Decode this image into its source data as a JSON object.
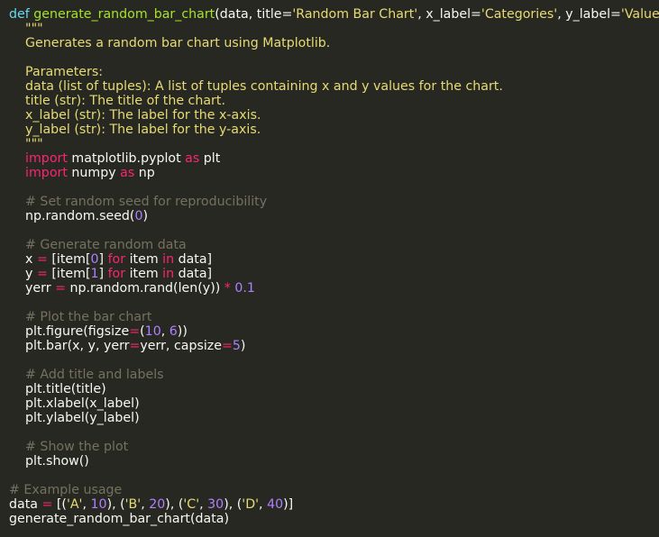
{
  "editor": {
    "language": "python",
    "theme_colors": {
      "background": "#272822",
      "text": "#f8f8f2",
      "keyword": "#66d9ef",
      "function": "#a6e22e",
      "string": "#e6db74",
      "number": "#ae81ff",
      "operator": "#f92672",
      "comment": "#75715e"
    },
    "lines": [
      [
        [
          "kw",
          "def "
        ],
        [
          "fn",
          "generate_random_bar_chart"
        ],
        [
          "p",
          "(data, title="
        ],
        [
          "str",
          "'Random Bar Chart'"
        ],
        [
          "p",
          ", x_label="
        ],
        [
          "str",
          "'Categories'"
        ],
        [
          "p",
          ", y_label="
        ],
        [
          "str",
          "'Values'"
        ],
        [
          "p",
          "):"
        ]
      ],
      [
        [
          "str",
          "    \"\"\""
        ]
      ],
      [
        [
          "str",
          "    Generates a random bar chart using Matplotlib."
        ]
      ],
      [],
      [
        [
          "str",
          "    Parameters:"
        ]
      ],
      [
        [
          "str",
          "    data (list of tuples): A list of tuples containing x and y values for the chart."
        ]
      ],
      [
        [
          "str",
          "    title (str): The title of the chart."
        ]
      ],
      [
        [
          "str",
          "    x_label (str): The label for the x-axis."
        ]
      ],
      [
        [
          "str",
          "    y_label (str): The label for the y-axis."
        ]
      ],
      [
        [
          "str",
          "    \"\"\""
        ]
      ],
      [
        [
          "p",
          "    "
        ],
        [
          "kw2",
          "import"
        ],
        [
          "p",
          " matplotlib.pyplot "
        ],
        [
          "kw2",
          "as"
        ],
        [
          "p",
          " plt"
        ]
      ],
      [
        [
          "p",
          "    "
        ],
        [
          "kw2",
          "import"
        ],
        [
          "p",
          " numpy "
        ],
        [
          "kw2",
          "as"
        ],
        [
          "p",
          " np"
        ]
      ],
      [],
      [
        [
          "cm",
          "    # Set random seed for reproducibility"
        ]
      ],
      [
        [
          "p",
          "    np.random.seed("
        ],
        [
          "num",
          "0"
        ],
        [
          "p",
          ")"
        ]
      ],
      [],
      [
        [
          "cm",
          "    # Generate random data"
        ]
      ],
      [
        [
          "p",
          "    x "
        ],
        [
          "op",
          "="
        ],
        [
          "p",
          " [item["
        ],
        [
          "num",
          "0"
        ],
        [
          "p",
          "] "
        ],
        [
          "kw2",
          "for"
        ],
        [
          "p",
          " item "
        ],
        [
          "kw2",
          "in"
        ],
        [
          "p",
          " data]"
        ]
      ],
      [
        [
          "p",
          "    y "
        ],
        [
          "op",
          "="
        ],
        [
          "p",
          " [item["
        ],
        [
          "num",
          "1"
        ],
        [
          "p",
          "] "
        ],
        [
          "kw2",
          "for"
        ],
        [
          "p",
          " item "
        ],
        [
          "kw2",
          "in"
        ],
        [
          "p",
          " data]"
        ]
      ],
      [
        [
          "p",
          "    yerr "
        ],
        [
          "op",
          "="
        ],
        [
          "p",
          " np.random.rand(len(y)) "
        ],
        [
          "op",
          "*"
        ],
        [
          "p",
          " "
        ],
        [
          "num",
          "0.1"
        ]
      ],
      [],
      [
        [
          "cm",
          "    # Plot the bar chart"
        ]
      ],
      [
        [
          "p",
          "    plt.figure(figsize"
        ],
        [
          "op",
          "="
        ],
        [
          "p",
          "("
        ],
        [
          "num",
          "10"
        ],
        [
          "p",
          ", "
        ],
        [
          "num",
          "6"
        ],
        [
          "p",
          "))"
        ]
      ],
      [
        [
          "p",
          "    plt.bar(x, y, yerr"
        ],
        [
          "op",
          "="
        ],
        [
          "p",
          "yerr, capsize"
        ],
        [
          "op",
          "="
        ],
        [
          "num",
          "5"
        ],
        [
          "p",
          ")"
        ]
      ],
      [],
      [
        [
          "cm",
          "    # Add title and labels"
        ]
      ],
      [
        [
          "p",
          "    plt.title(title)"
        ]
      ],
      [
        [
          "p",
          "    plt.xlabel(x_label)"
        ]
      ],
      [
        [
          "p",
          "    plt.ylabel(y_label)"
        ]
      ],
      [],
      [
        [
          "cm",
          "    # Show the plot"
        ]
      ],
      [
        [
          "p",
          "    plt.show()"
        ]
      ],
      [],
      [
        [
          "cm",
          "# Example usage"
        ]
      ],
      [
        [
          "p",
          "data "
        ],
        [
          "op",
          "="
        ],
        [
          "p",
          " [("
        ],
        [
          "str",
          "'A'"
        ],
        [
          "p",
          ", "
        ],
        [
          "num",
          "10"
        ],
        [
          "p",
          "), ("
        ],
        [
          "str",
          "'B'"
        ],
        [
          "p",
          ", "
        ],
        [
          "num",
          "20"
        ],
        [
          "p",
          "), ("
        ],
        [
          "str",
          "'C'"
        ],
        [
          "p",
          ", "
        ],
        [
          "num",
          "30"
        ],
        [
          "p",
          "), ("
        ],
        [
          "str",
          "'D'"
        ],
        [
          "p",
          ", "
        ],
        [
          "num",
          "40"
        ],
        [
          "p",
          ")]"
        ]
      ],
      [
        [
          "p",
          "generate_random_bar_chart(data)"
        ]
      ]
    ]
  }
}
